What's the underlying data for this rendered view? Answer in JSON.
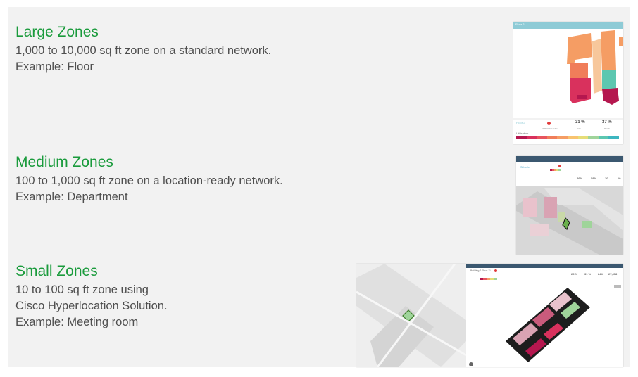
{
  "zones": [
    {
      "title": "Large Zones",
      "description": "1,000 to 10,000 sq ft zone on a standard network.\nExample: Floor"
    },
    {
      "title": "Medium Zones",
      "description": "100 to 1,000 sq ft zone on a location-ready network.\nExample: Department"
    },
    {
      "title": "Small Zones",
      "description": "10 to 100 sq ft zone using\nCisco Hyperlocation Solution.\nExample: Meeting room"
    }
  ],
  "large_preview": {
    "header": "Floor 2",
    "floor_label": "Floor 2",
    "service_level_label": "SERVICE LEVEL",
    "avg_value": "31 %",
    "avg_label": "AVG",
    "peak_value": "37 %",
    "peak_label": "PEAK",
    "utilization_label": "Utilization",
    "header_color": "#8ecbd6",
    "scale_colors": [
      "#b5174f",
      "#d9315d",
      "#e8555e",
      "#f07d5a",
      "#f59d64",
      "#f8c36f",
      "#e6dd78",
      "#9fd49a",
      "#5cc7b0",
      "#3db6c0"
    ]
  },
  "medium_preview": {
    "zone_label": "SJ-Infer",
    "metric_1": "46%",
    "metric_2": "58%",
    "metric_3": "10",
    "metric_4": "10",
    "header_color": "#3b5870"
  },
  "small_preview": {
    "header_label": "Building 2 Floor 11",
    "metric_1": "25 %",
    "metric_2": "31 %",
    "metric_3": "244",
    "metric_4": "27,478",
    "header_color": "#3b5870"
  }
}
